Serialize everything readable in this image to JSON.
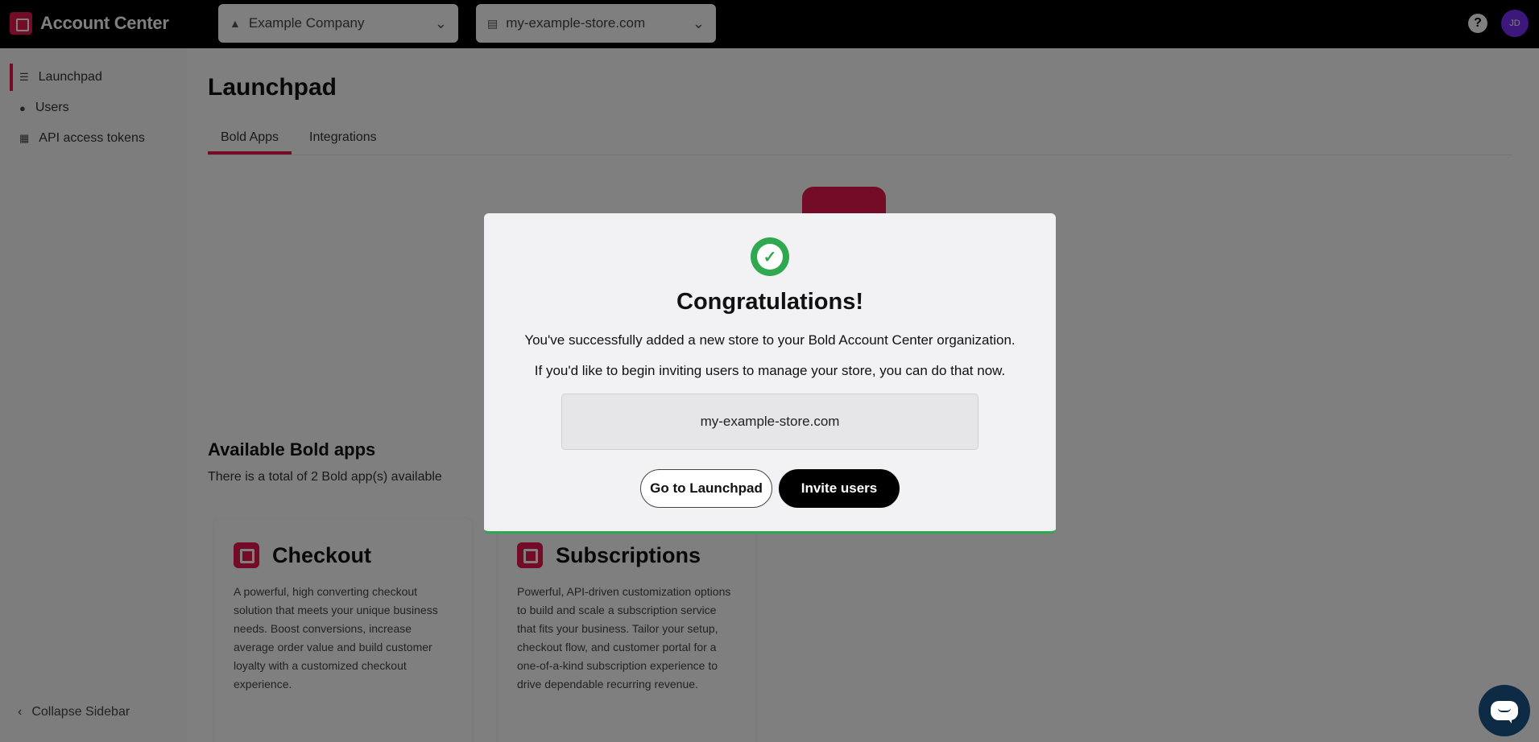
{
  "header": {
    "app_name": "Account Center",
    "company_selector": "Example Company",
    "store_selector": "my-example-store.com",
    "help_label": "?",
    "avatar_initials": "JD"
  },
  "sidebar": {
    "items": [
      {
        "label": "Launchpad",
        "icon": "rocket-icon",
        "active": true
      },
      {
        "label": "Users",
        "icon": "users-icon",
        "active": false
      },
      {
        "label": "API access tokens",
        "icon": "token-icon",
        "active": false
      }
    ],
    "collapse_label": "Collapse Sidebar"
  },
  "main": {
    "title": "Launchpad",
    "tabs": [
      {
        "label": "Bold Apps",
        "active": true
      },
      {
        "label": "Integrations",
        "active": false
      }
    ],
    "available_title": "Available Bold apps",
    "available_subtitle": "There is a total of 2 Bold app(s) available",
    "apps": [
      {
        "name": "Checkout",
        "description": "A powerful, high converting checkout solution that meets your unique business needs. Boost conversions, increase average order value and build customer loyalty with a customized checkout experience."
      },
      {
        "name": "Subscriptions",
        "description": "Powerful, API-driven customization options to build and scale a subscription service that fits your business. Tailor your setup, checkout flow, and customer portal for a one-of-a-kind subscription experience to drive dependable recurring revenue."
      }
    ]
  },
  "modal": {
    "title": "Congratulations!",
    "line1": "You've successfully added a new store to your Bold Account Center organization.",
    "line2": "If you'd like to begin inviting users to manage your store, you can do that now.",
    "store": "my-example-store.com",
    "secondary_button": "Go to Launchpad",
    "primary_button": "Invite users"
  },
  "colors": {
    "brand": "#e8174f",
    "success": "#2fa84f",
    "chat": "#0d2b45"
  }
}
